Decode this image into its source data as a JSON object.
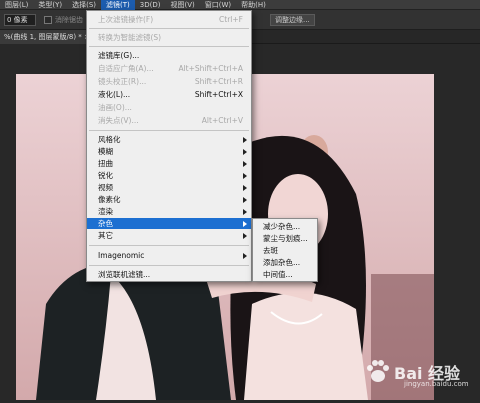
{
  "menubar": {
    "items": [
      "图层(L)",
      "类型(Y)",
      "选择(S)",
      "滤镜(T)",
      "3D(D)",
      "视图(V)",
      "窗口(W)",
      "帮助(H)"
    ],
    "active_index": 3
  },
  "options": {
    "field_value": "0 像素",
    "checkbox_label": "消除锯齿",
    "refine_edge_label": "调整边缘..."
  },
  "tab": {
    "title": "%(曲线 1, 图层蒙版/8) * ×"
  },
  "filter_menu": {
    "items": [
      {
        "label": "上次滤镜操作(F)",
        "shortcut": "Ctrl+F",
        "enabled": false
      },
      {
        "label": "转换为智能滤镜(S)",
        "shortcut": "",
        "enabled": false
      },
      {
        "label": "滤镜库(G)...",
        "shortcut": "",
        "enabled": true
      },
      {
        "label": "自适应广角(A)...",
        "shortcut": "Alt+Shift+Ctrl+A",
        "enabled": false
      },
      {
        "label": "镜头校正(R)...",
        "shortcut": "Shift+Ctrl+R",
        "enabled": false
      },
      {
        "label": "液化(L)...",
        "shortcut": "Shift+Ctrl+X",
        "enabled": true
      },
      {
        "label": "油画(O)...",
        "shortcut": "",
        "enabled": false
      },
      {
        "label": "消失点(V)...",
        "shortcut": "Alt+Ctrl+V",
        "enabled": false
      },
      {
        "label": "风格化",
        "submenu": true
      },
      {
        "label": "模糊",
        "submenu": true
      },
      {
        "label": "扭曲",
        "submenu": true
      },
      {
        "label": "锐化",
        "submenu": true
      },
      {
        "label": "视频",
        "submenu": true
      },
      {
        "label": "像素化",
        "submenu": true
      },
      {
        "label": "渲染",
        "submenu": true
      },
      {
        "label": "杂色",
        "submenu": true,
        "highlighted": true
      },
      {
        "label": "其它",
        "submenu": true
      },
      {
        "label": "Imagenomic",
        "submenu": true
      },
      {
        "label": "浏览联机滤镜...",
        "shortcut": ""
      }
    ]
  },
  "noise_submenu": {
    "items": [
      "减少杂色...",
      "蒙尘与划痕...",
      "去斑",
      "添加杂色...",
      "中间值..."
    ]
  },
  "watermark": {
    "brand": "Bai 经验",
    "sub": "jingyan.baidu.com"
  },
  "colors": {
    "highlight": "#1c6fd1",
    "menu_bg": "#efefef",
    "app_bg": "#2b2b2b"
  }
}
